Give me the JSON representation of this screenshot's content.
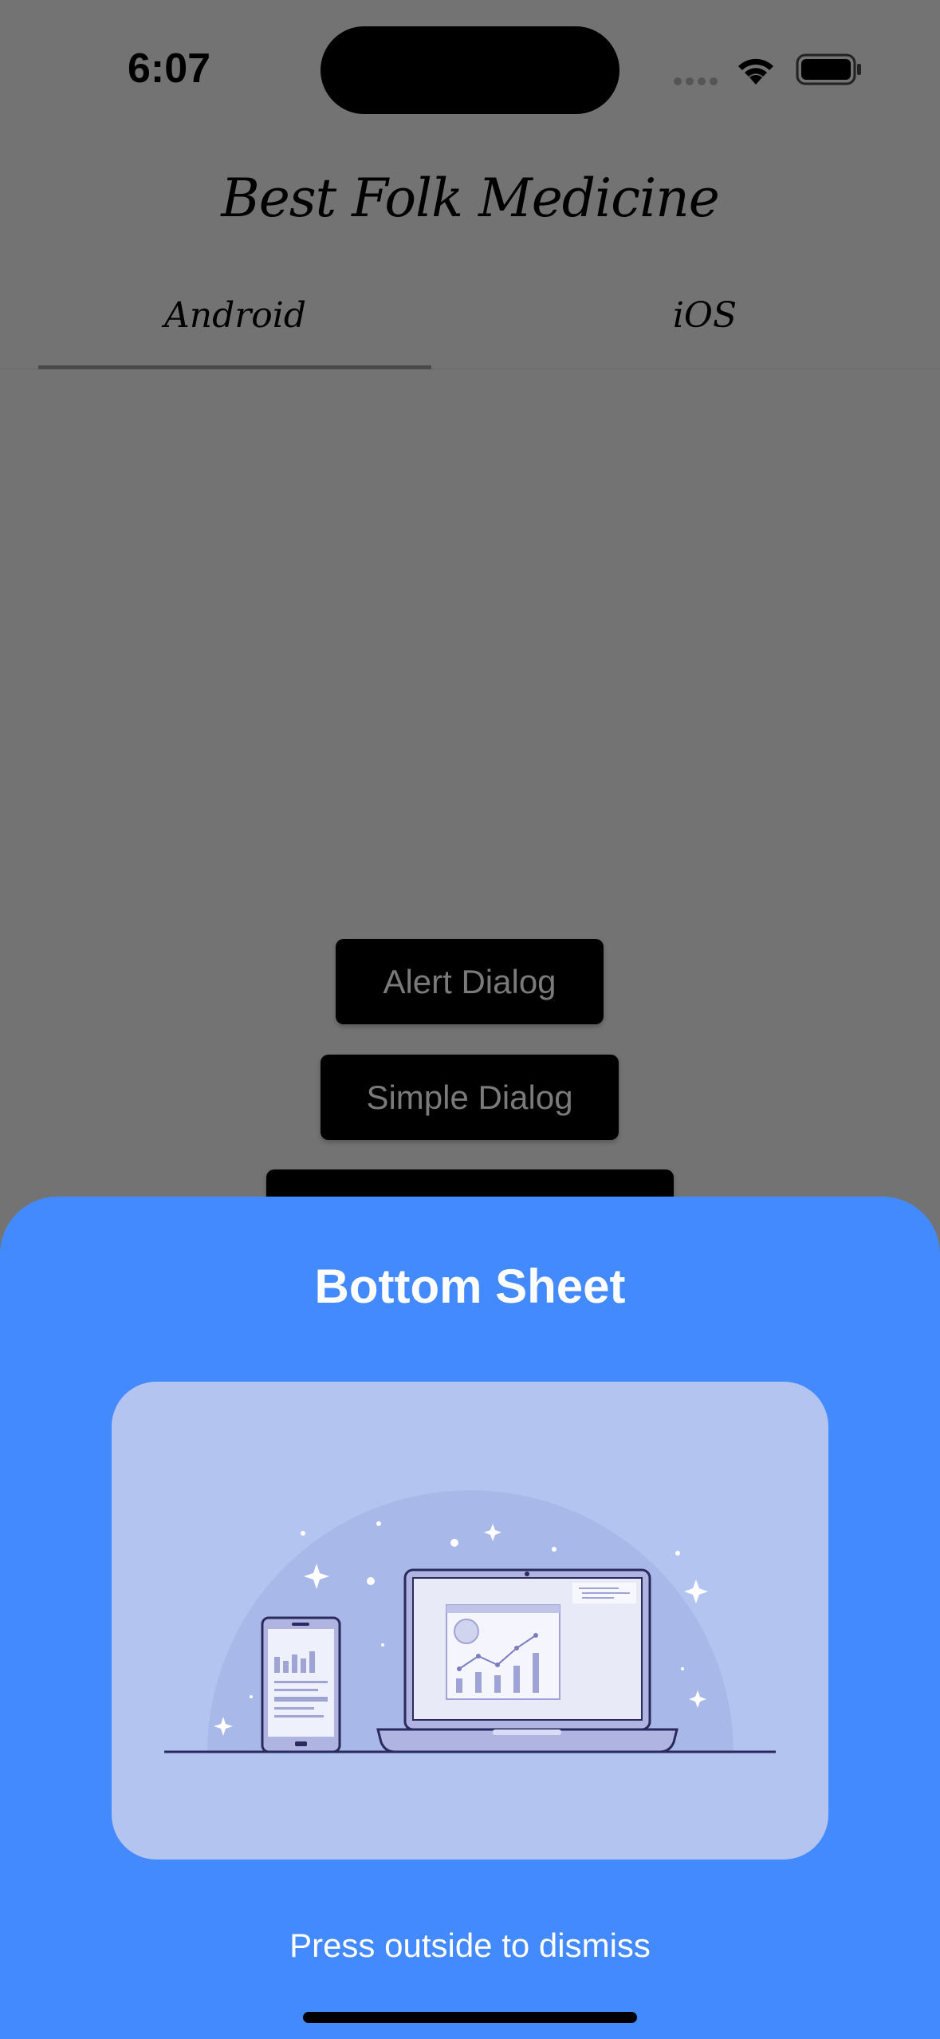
{
  "status_bar": {
    "time": "6:07"
  },
  "app": {
    "title": "Best Folk Medicine",
    "tabs": [
      {
        "label": "Android",
        "selected": true
      },
      {
        "label": "iOS",
        "selected": false
      }
    ]
  },
  "buttons": {
    "alert_dialog": "Alert Dialog",
    "simple_dialog": "Simple Dialog"
  },
  "bottom_sheet": {
    "title": "Bottom Sheet",
    "hint": "Press outside to dismiss",
    "background_color": "#448aff",
    "illustration": "devices-analytics-illustration"
  },
  "colors": {
    "scrim": "#737373",
    "button_bg": "#000000",
    "illustration_bg": "#b3c4f0"
  }
}
